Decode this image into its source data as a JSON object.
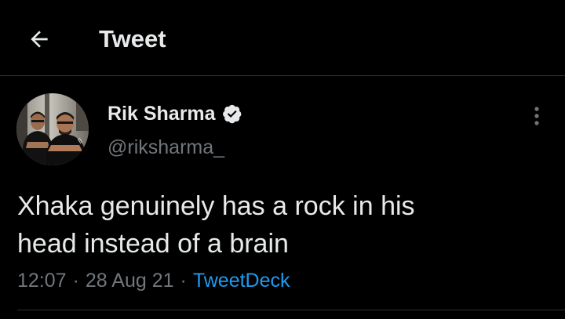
{
  "header": {
    "back_icon": "arrow-left-icon",
    "title": "Tweet"
  },
  "tweet": {
    "author": {
      "display_name": "Rik Sharma",
      "verified_icon": "verified-badge-icon",
      "handle": "@riksharma_"
    },
    "more_icon": "more-vertical-icon",
    "text": "Xhaka genuinely has a rock in his\nhead instead of a brain",
    "meta": {
      "time": "12:07",
      "separator": "·",
      "date": "28 Aug 21",
      "source": "TweetDeck"
    }
  },
  "colors": {
    "background": "#000000",
    "text_primary": "#e7e9ea",
    "text_secondary": "#71767b",
    "link": "#1d9bf0",
    "divider": "#2f3336"
  }
}
